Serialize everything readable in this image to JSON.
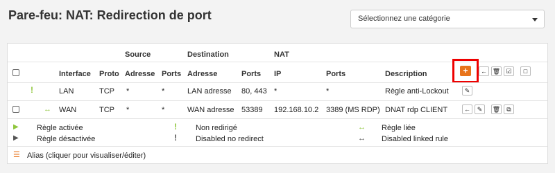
{
  "page": {
    "title": "Pare-feu: NAT: Redirection de port"
  },
  "category_select": {
    "value": "Sélectionnez une catégorie"
  },
  "table": {
    "group_headers": {
      "source": "Source",
      "destination": "Destination",
      "nat": "NAT"
    },
    "columns": {
      "interface": "Interface",
      "proto": "Proto",
      "src_address": "Adresse",
      "src_ports": "Ports",
      "dst_address": "Adresse",
      "dst_ports": "Ports",
      "nat_ip": "IP",
      "nat_ports": "Ports",
      "description": "Description"
    },
    "rows": [
      {
        "interface": "LAN",
        "proto": "TCP",
        "src_address": "*",
        "src_ports": "*",
        "dst_address": "LAN adresse",
        "dst_ports": "80, 443",
        "nat_ip": "*",
        "nat_ports": "*",
        "description": "Règle anti-Lockout"
      },
      {
        "interface": "WAN",
        "proto": "TCP",
        "src_address": "*",
        "src_ports": "*",
        "dst_address": "WAN adresse",
        "dst_ports": "53389",
        "nat_ip": "192.168.10.2",
        "nat_ports": "3389 (MS RDP)",
        "description": "DNAT rdp CLIENT"
      }
    ]
  },
  "legend": {
    "enabled": "Règle activée",
    "disabled": "Règle désactivée",
    "no_redirect": "Non redirigé",
    "disabled_no_redirect": "Disabled no redirect",
    "linked": "Règle liée",
    "disabled_linked": "Disabled linked rule",
    "alias": "Alias (cliquer pour visualiser/éditer)"
  },
  "icons": {
    "add": "plus-icon",
    "move": "arrow-left-icon",
    "delete": "trash-icon",
    "enable": "check-square-icon",
    "select": "square-icon",
    "edit": "pencil-icon",
    "copy": "copy-icon",
    "no_redirect": "exclamation-icon",
    "linked": "double-arrow-icon",
    "alias": "list-icon"
  },
  "colors": {
    "accent": "#e8741b",
    "enabled": "#8fc63d",
    "highlight": "#e00000"
  }
}
